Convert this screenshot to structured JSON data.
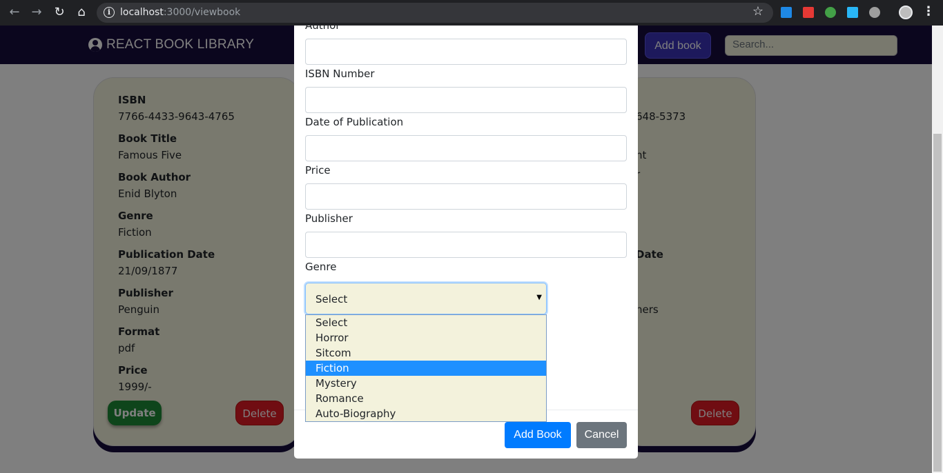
{
  "browser": {
    "url_host": "localhost",
    "url_path": ":3000/viewbook"
  },
  "navbar": {
    "brand": "REACT BOOK LIBRARY",
    "add_book_label": "Add book",
    "search_placeholder": "Search..."
  },
  "card_left": {
    "fields": [
      {
        "label": "ISBN",
        "value": "7766-4433-9643-4765"
      },
      {
        "label": "Book Title",
        "value": "Famous Five"
      },
      {
        "label": "Book Author",
        "value": "Enid Blyton"
      },
      {
        "label": "Genre",
        "value": "Fiction"
      },
      {
        "label": "Publication Date",
        "value": "21/09/1877"
      },
      {
        "label": "Publisher",
        "value": "Penguin"
      },
      {
        "label": "Format",
        "value": "pdf"
      },
      {
        "label": "Price",
        "value": "1999/-"
      }
    ],
    "update_label": "Update",
    "delete_label": "Delete"
  },
  "card_right": {
    "isbn_fragment": "648-5373",
    "title_fragment": "nt",
    "author_fragment": "r",
    "pubdate_fragment": "Date",
    "publisher_fragment": "ners",
    "delete_label": "Delete"
  },
  "nav_fragment": ":",
  "modal": {
    "author_label": "Author",
    "isbn_label": "ISBN Number",
    "date_label": "Date of Publication",
    "price_label": "Price",
    "publisher_label": "Publisher",
    "genre_label": "Genre",
    "genre_selected": "Select",
    "genre_options": [
      "Select",
      "Horror",
      "Sitcom",
      "Fiction",
      "Mystery",
      "Romance",
      "Auto-Biography"
    ],
    "highlighted_option": "Fiction",
    "add_book_label": "Add Book",
    "cancel_label": "Cancel"
  }
}
